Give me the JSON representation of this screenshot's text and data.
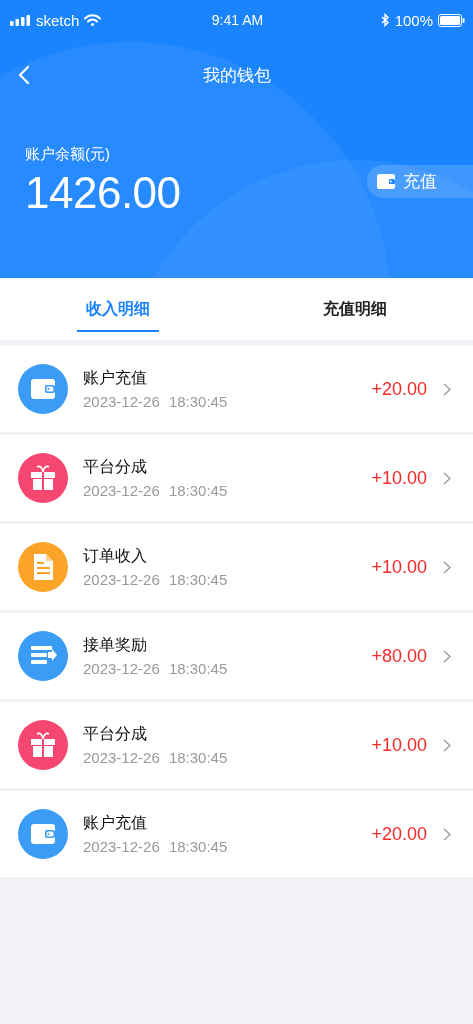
{
  "status_bar": {
    "carrier": "sketch",
    "time": "9:41 AM",
    "battery": "100%"
  },
  "nav": {
    "title": "我的钱包"
  },
  "balance": {
    "label": "账户余额(元)",
    "amount": "1426.00",
    "recharge_button": "充值"
  },
  "tabs": [
    {
      "label": "收入明细",
      "selected": true
    },
    {
      "label": "充值明细",
      "selected": false
    }
  ],
  "records": [
    {
      "kind": "wallet",
      "color": "#3a9cf5",
      "title": "账户充值",
      "time": "2023-12-26 18:30:45",
      "amount": "+20.00"
    },
    {
      "kind": "gift",
      "color": "#f5476f",
      "title": "平台分成",
      "time": "2023-12-26 18:30:45",
      "amount": "+10.00"
    },
    {
      "kind": "document",
      "color": "#fca428",
      "title": "订单收入",
      "time": "2023-12-26 18:30:45",
      "amount": "+10.00"
    },
    {
      "kind": "transfer",
      "color": "#3a9cf5",
      "title": "接单奖励",
      "time": "2023-12-26 18:30:45",
      "amount": "+80.00"
    },
    {
      "kind": "gift",
      "color": "#f5476f",
      "title": "平台分成",
      "time": "2023-12-26 18:30:45",
      "amount": "+10.00"
    },
    {
      "kind": "wallet",
      "color": "#3a9cf5",
      "title": "账户充值",
      "time": "2023-12-26 18:30:45",
      "amount": "+20.00"
    }
  ]
}
